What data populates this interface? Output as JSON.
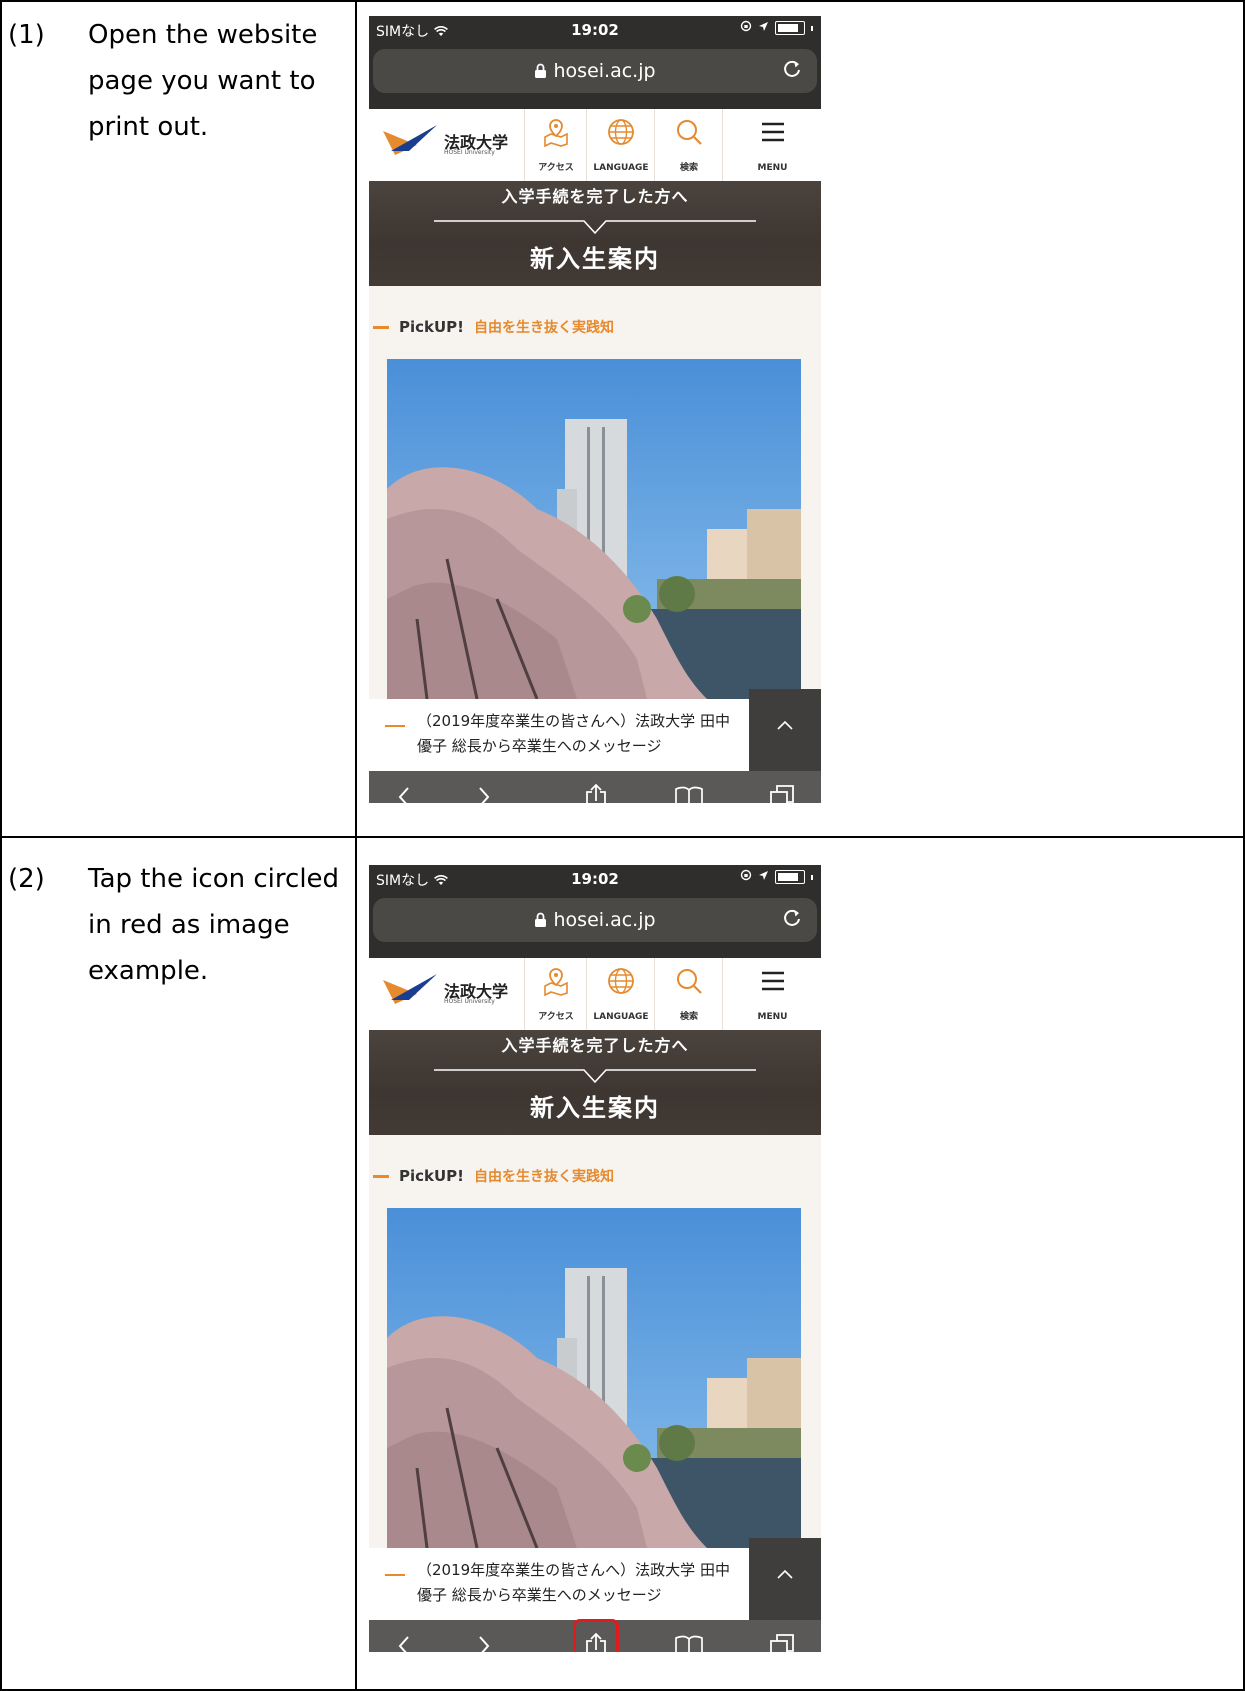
{
  "steps": [
    {
      "number": "(1)",
      "text": "Open the website page you want to print out."
    },
    {
      "number": "(2)",
      "text": "Tap the icon circled in red as image example."
    }
  ],
  "phone": {
    "status": {
      "carrier": "SIMなし",
      "time": "19:02"
    },
    "address_bar": {
      "url": "hosei.ac.jp"
    },
    "site_header": {
      "logo_name": "法政大学",
      "logo_sub": "HOSEI University",
      "nav": [
        {
          "label": "アクセス",
          "icon": "map-pin-icon"
        },
        {
          "label": "LANGUAGE",
          "icon": "globe-icon"
        },
        {
          "label": "検索",
          "icon": "search-icon"
        },
        {
          "label": "MENU",
          "icon": "hamburger-icon"
        }
      ]
    },
    "banner": {
      "subtitle": "入学手続を完了した方へ",
      "title": "新入生案内"
    },
    "pickup": {
      "label": "PickUP!",
      "tag": "自由を生き抜く実践知"
    },
    "caption": {
      "line1": "（2019年度卒業生の皆さんへ）法政大学 田中",
      "line2": "優子 総長から卒業生へのメッセージ"
    },
    "toolbar_icons": [
      "back-icon",
      "forward-icon",
      "share-icon",
      "bookmarks-icon",
      "tabs-icon"
    ]
  },
  "colors": {
    "highlight": "#e01b1b",
    "accent_orange": "#e58a2e",
    "browser_chrome": "#2f2e2c"
  }
}
